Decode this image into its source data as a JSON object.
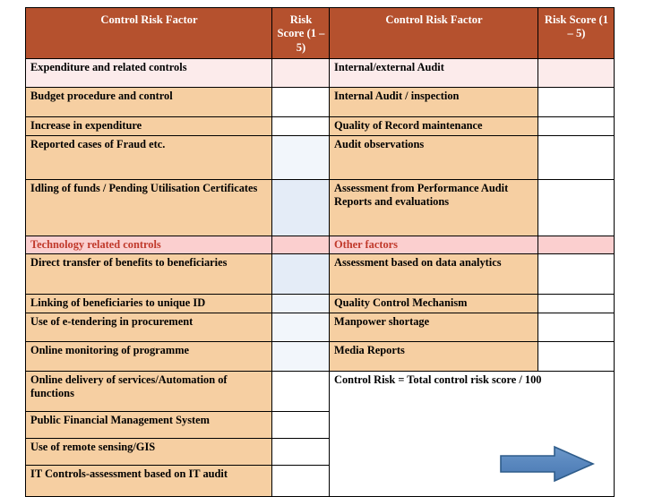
{
  "table": {
    "headers": [
      {
        "label": "Control Risk Factor"
      },
      {
        "label": "Risk Score (1 – 5)"
      },
      {
        "label": "Control Risk Factor"
      },
      {
        "label": "Risk Score (1 – 5)"
      }
    ],
    "rows": [
      {
        "left": "Expenditure and related controls",
        "right": "Internal/external Audit",
        "kind": "section"
      },
      {
        "left": "Budget procedure and control",
        "right": "Internal Audit / inspection",
        "kind": "data"
      },
      {
        "left": "Increase in expenditure",
        "right": "Quality of Record maintenance",
        "kind": "data"
      },
      {
        "left": "Reported cases of Fraud etc.",
        "right": "Audit observations",
        "kind": "data"
      },
      {
        "left": "Idling of funds / Pending Utilisation Certificates",
        "right": "Assessment from Performance Audit Reports and evaluations",
        "kind": "data"
      },
      {
        "left": "Technology related controls",
        "right": "Other factors",
        "kind": "section"
      },
      {
        "left": "Direct transfer of benefits to beneficiaries",
        "right": "Assessment based on  data analytics",
        "kind": "data"
      },
      {
        "left": "Linking of beneficiaries to unique ID",
        "right": "Quality Control Mechanism",
        "kind": "data"
      },
      {
        "left": "Use of e-tendering in procurement",
        "right": "Manpower shortage",
        "kind": "data"
      },
      {
        "left": "Online monitoring of programme",
        "right": "Media Reports",
        "kind": "data"
      },
      {
        "left": "Online delivery of services/Automation of functions",
        "right": "",
        "kind": "data"
      },
      {
        "left": "Public Financial Management System",
        "right": "",
        "kind": "data"
      },
      {
        "left": "Use of remote sensing/GIS",
        "right": "",
        "kind": "data"
      },
      {
        "left": "IT Controls-assessment based on IT audit",
        "right": "",
        "kind": "data"
      }
    ],
    "formula": "Control Risk  = Total control risk score / 100",
    "score_values": {
      "col2": [
        "",
        "",
        "",
        "",
        "",
        "",
        "",
        "",
        "",
        "",
        "",
        "",
        "",
        ""
      ],
      "col4": [
        "",
        "",
        "",
        "",
        "",
        "",
        "",
        "",
        "",
        ""
      ]
    }
  },
  "arrow": {
    "name": "right-arrow",
    "direction": "right",
    "fill": "#5a88bf",
    "stroke": "#2e5c8a"
  },
  "colors": {
    "header_bg": "#b5512e",
    "header_text": "#ffffff",
    "factor_bg": "#f6cfa2",
    "section_bg": "#fcebeb",
    "section_text": "#9e2a22",
    "section_bg_alt": "#fbcfcf",
    "section_text_alt": "#c0392b",
    "border": "#000000"
  }
}
